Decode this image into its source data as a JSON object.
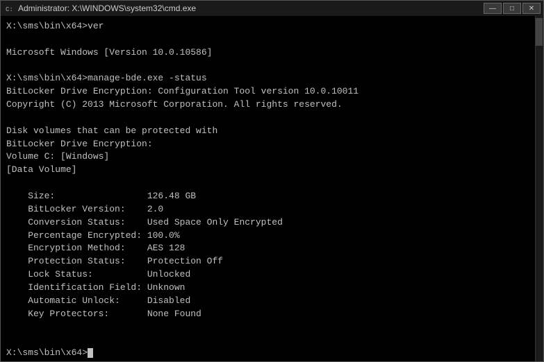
{
  "window": {
    "title": "Administrator: X:\\WINDOWS\\system32\\cmd.exe",
    "icon": "▶"
  },
  "buttons": {
    "minimize": "—",
    "maximize": "□",
    "close": "✕"
  },
  "terminal": {
    "lines": [
      "X:\\sms\\bin\\x64>ver",
      "",
      "Microsoft Windows [Version 10.0.10586]",
      "",
      "X:\\sms\\bin\\x64>manage-bde.exe -status",
      "BitLocker Drive Encryption: Configuration Tool version 10.0.10011",
      "Copyright (C) 2013 Microsoft Corporation. All rights reserved.",
      "",
      "Disk volumes that can be protected with",
      "BitLocker Drive Encryption:",
      "Volume C: [Windows]",
      "[Data Volume]",
      "",
      "    Size:                 126.48 GB",
      "    BitLocker Version:    2.0",
      "    Conversion Status:    Used Space Only Encrypted",
      "    Percentage Encrypted: 100.0%",
      "    Encryption Method:    AES 128",
      "    Protection Status:    Protection Off",
      "    Lock Status:          Unlocked",
      "    Identification Field: Unknown",
      "    Automatic Unlock:     Disabled",
      "    Key Protectors:       None Found",
      "",
      "",
      "X:\\sms\\bin\\x64>"
    ]
  }
}
